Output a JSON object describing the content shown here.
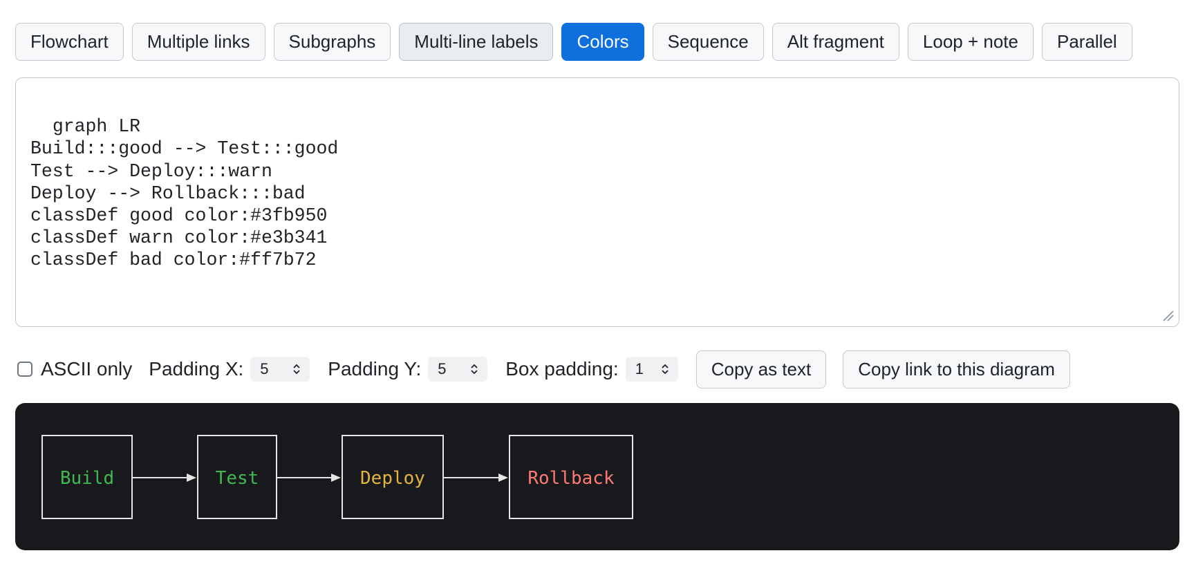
{
  "tabs": [
    {
      "label": "Flowchart"
    },
    {
      "label": "Multiple links"
    },
    {
      "label": "Subgraphs"
    },
    {
      "label": "Multi-line labels"
    },
    {
      "label": "Colors"
    },
    {
      "label": "Sequence"
    },
    {
      "label": "Alt fragment"
    },
    {
      "label": "Loop + note"
    },
    {
      "label": "Parallel"
    }
  ],
  "active_tab": "Colors",
  "editor": {
    "value": "graph LR\nBuild:::good --> Test:::good\nTest --> Deploy:::warn\nDeploy --> Rollback:::bad\nclassDef good color:#3fb950\nclassDef warn color:#e3b341\nclassDef bad color:#ff7b72"
  },
  "options": {
    "ascii_only_label": "ASCII only",
    "ascii_only_checked": false,
    "padding_x_label": "Padding X:",
    "padding_x_value": "5",
    "padding_y_label": "Padding Y:",
    "padding_y_value": "5",
    "box_padding_label": "Box padding:",
    "box_padding_value": "1",
    "copy_text_label": "Copy as text",
    "copy_link_label": "Copy link to this diagram"
  },
  "diagram": {
    "background": "#18191c",
    "border_color": "#e6e6e6",
    "nodes": [
      {
        "label": "Build",
        "color": "#3fb950"
      },
      {
        "label": "Test",
        "color": "#3fb950"
      },
      {
        "label": "Deploy",
        "color": "#e3b341"
      },
      {
        "label": "Rollback",
        "color": "#ff7b72"
      }
    ]
  },
  "colors": {
    "accent": "#0f6fdc",
    "good": "#3fb950",
    "warn": "#e3b341",
    "bad": "#ff7b72"
  }
}
